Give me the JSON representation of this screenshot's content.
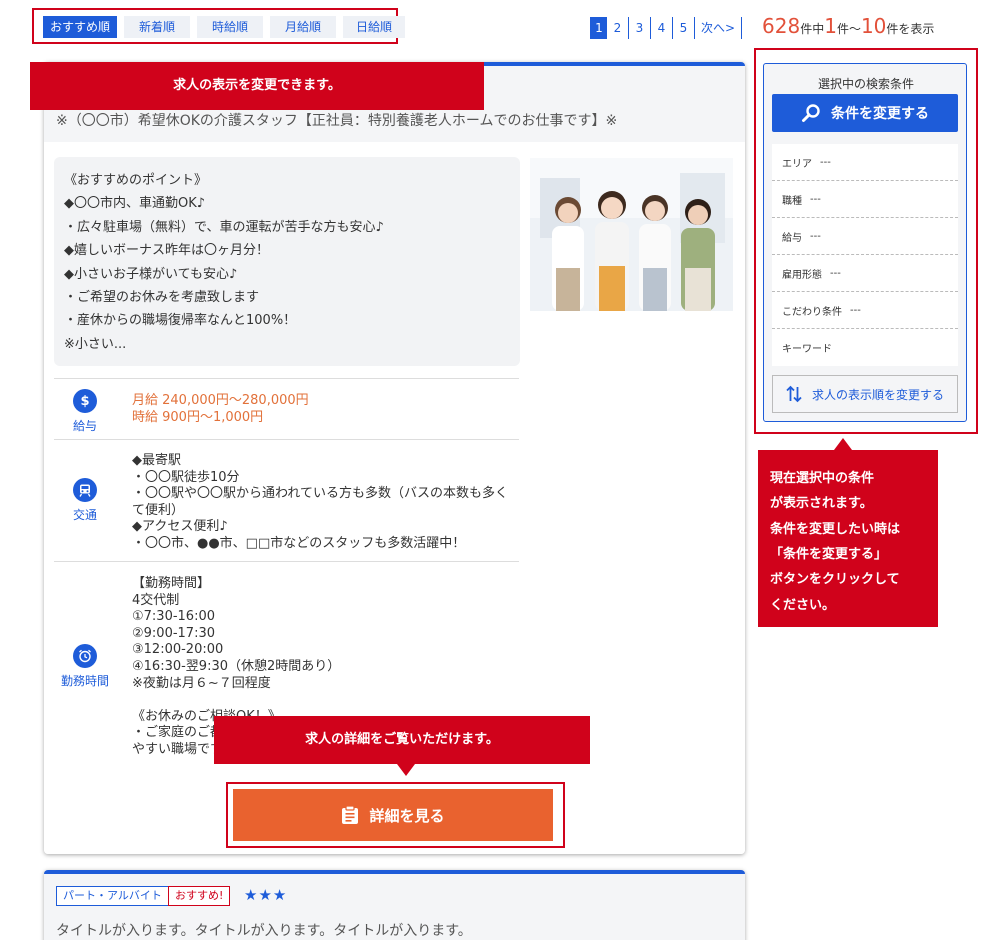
{
  "sort": {
    "tabs": [
      "おすすめ順",
      "新着順",
      "時給順",
      "月給順",
      "日給順"
    ],
    "active": 0
  },
  "pagination": {
    "pages": [
      "1",
      "2",
      "3",
      "4",
      "5"
    ],
    "current": "1",
    "next_label": "次へ>"
  },
  "results": {
    "total": "628",
    "total_suffix": "件中",
    "from": "1",
    "from_suffix": "件～",
    "to": "10",
    "to_suffix": "件を表示"
  },
  "callouts": {
    "sort": "求人の表示を変更できます。",
    "detail": "求人の詳細をご覧いただけます。",
    "condition": "現在選択中の条件\nが表示されます。\n条件を変更したい時は\n「条件を変更する」\nボタンをクリックして\nください。"
  },
  "job": {
    "title": "※（〇〇市）希望休OKの介護スタッフ【正社員：特別養護老人ホームでのお仕事です】※",
    "points": "《おすすめのポイント》\n◆〇〇市内、車通勤OK♪\n・広々駐車場（無料）で、車の運転が苦手な方も安心♪\n◆嬉しいボーナス昨年は〇ヶ月分！\n◆小さいお子様がいても安心♪\n・ご希望のお休みを考慮致します\n・産休からの職場復帰率なんと100%！\n※小さい...",
    "salary_label": "給与",
    "salary": "月給 240,000円～280,000円\n時給 900円～1,000円",
    "access_label": "交通",
    "access": "◆最寄駅\n・〇〇駅徒歩10分\n・〇〇駅や〇〇駅から通われている方も多数（バスの本数も多くて便利）\n◆アクセス便利♪\n・〇〇市、●●市、□□市などのスタッフも多数活躍中！",
    "hours_label": "勤務時間",
    "hours": "【勤務時間】\n4交代制\n①7:30-16:00\n②9:00-17:30\n③12:00-20:00\n④16:30-翌9:30（休憩2時間あり）\n※夜勤は月６~７回程度\n\n《お休みのご相談OK！》\n・ご家庭のご都合\nやすい職場です",
    "detail_button": "詳細を見る"
  },
  "sidebar": {
    "title": "選択中の検索条件",
    "change_button": "条件を変更する",
    "conditions": [
      {
        "label": "エリア",
        "value": "---"
      },
      {
        "label": "職種",
        "value": "---"
      },
      {
        "label": "給与",
        "value": "---"
      },
      {
        "label": "雇用形態",
        "value": "---"
      },
      {
        "label": "こだわり条件",
        "value": "---"
      },
      {
        "label": "キーワード",
        "value": ""
      }
    ],
    "order_button": "求人の表示順を変更する"
  },
  "job2": {
    "tag_employment": "パート・アルバイト",
    "tag_recommend": "おすすめ!",
    "stars": "★★★",
    "title": "タイトルが入ります。タイトルが入ります。タイトルが入ります。"
  },
  "colors": {
    "primary": "#1e5cd9",
    "callout": "#d0021b",
    "detail_button": "#e9622f",
    "salary_text": "#e2713a"
  }
}
